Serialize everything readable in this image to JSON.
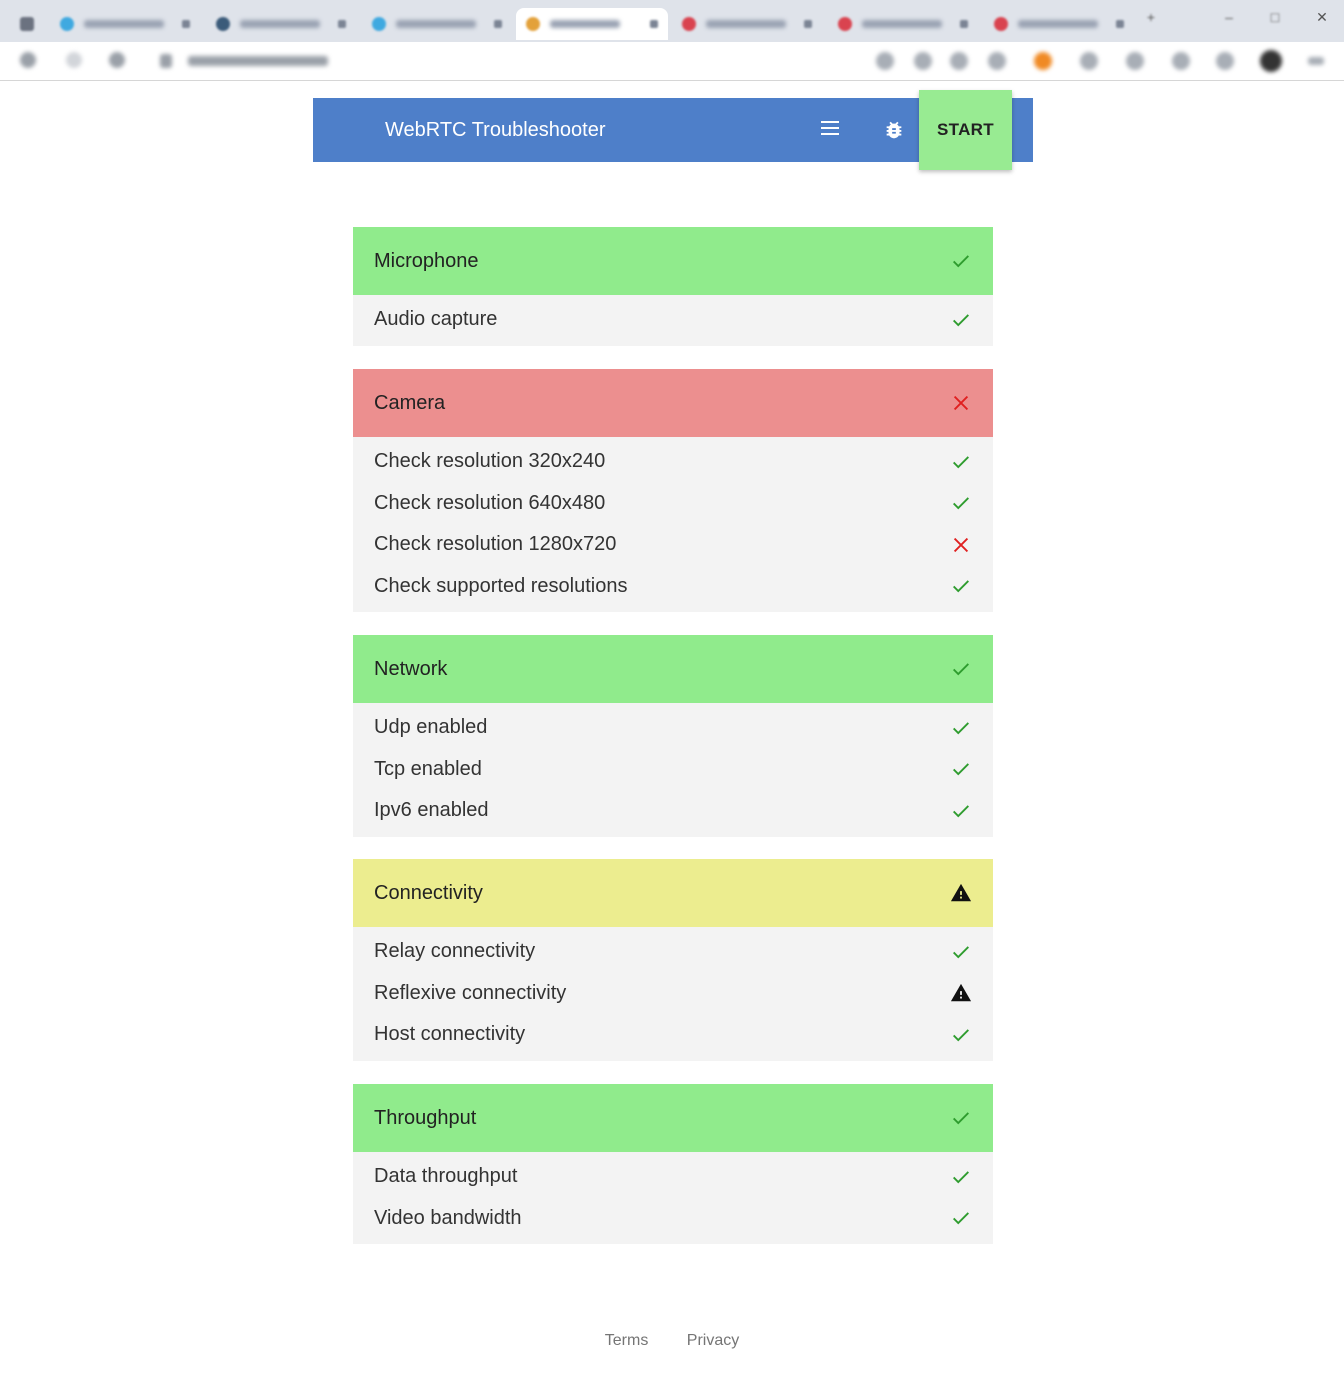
{
  "app": {
    "title": "WebRTC Troubleshooter",
    "start_label": "START"
  },
  "colors": {
    "header": "#4e7fc9",
    "start": "#98eb92",
    "pass": "#90eb8c",
    "fail": "#ec8f8f",
    "warn": "#eced8f",
    "row_bg": "#f3f3f3",
    "check": "#2e9c2e",
    "cross": "#e02020"
  },
  "sections": [
    {
      "title": "Microphone",
      "status": "pass",
      "icon": "check-icon",
      "tests": [
        {
          "label": "Audio capture",
          "status": "pass"
        }
      ]
    },
    {
      "title": "Camera",
      "status": "fail",
      "icon": "cross-icon",
      "tests": [
        {
          "label": "Check resolution 320x240",
          "status": "pass"
        },
        {
          "label": "Check resolution 640x480",
          "status": "pass"
        },
        {
          "label": "Check resolution 1280x720",
          "status": "fail"
        },
        {
          "label": "Check supported resolutions",
          "status": "pass"
        }
      ]
    },
    {
      "title": "Network",
      "status": "pass",
      "icon": "check-icon",
      "tests": [
        {
          "label": "Udp enabled",
          "status": "pass"
        },
        {
          "label": "Tcp enabled",
          "status": "pass"
        },
        {
          "label": "Ipv6 enabled",
          "status": "pass"
        }
      ]
    },
    {
      "title": "Connectivity",
      "status": "warn",
      "icon": "warning-icon",
      "tests": [
        {
          "label": "Relay connectivity",
          "status": "pass"
        },
        {
          "label": "Reflexive connectivity",
          "status": "warn"
        },
        {
          "label": "Host connectivity",
          "status": "pass"
        }
      ]
    },
    {
      "title": "Throughput",
      "status": "pass",
      "icon": "check-icon",
      "tests": [
        {
          "label": "Data throughput",
          "status": "pass"
        },
        {
          "label": "Video bandwidth",
          "status": "pass"
        }
      ]
    }
  ],
  "footer": {
    "terms": "Terms",
    "privacy": "Privacy"
  }
}
